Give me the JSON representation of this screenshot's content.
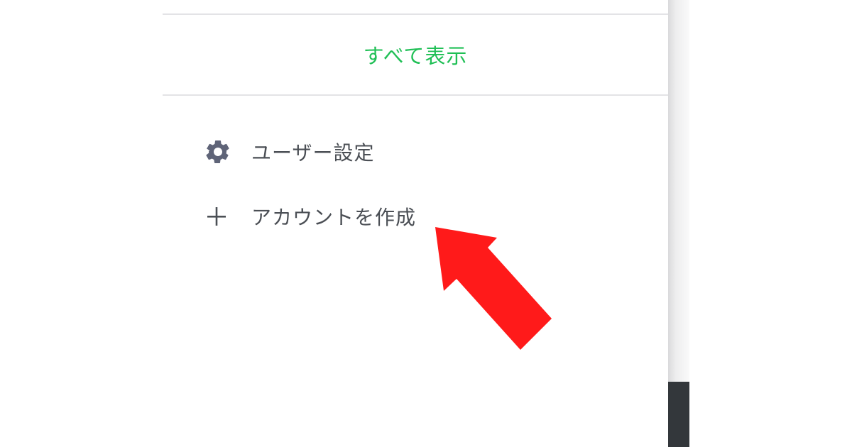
{
  "menu": {
    "show_all_label": "すべて表示",
    "items": [
      {
        "label": "ユーザー設定",
        "icon": "gear-icon"
      },
      {
        "label": "アカウントを作成",
        "icon": "plus-icon"
      }
    ]
  },
  "colors": {
    "accent_green": "#1fbf55",
    "text_gray": "#4b4f55",
    "icon_gray": "#5f6478",
    "divider": "#e3e3e6",
    "annotation_red": "#ff1a1a",
    "scrollbar_dark": "#33373b"
  },
  "annotation": {
    "type": "arrow",
    "color": "#ff1a1a",
    "target": "create-account-menu-item"
  }
}
